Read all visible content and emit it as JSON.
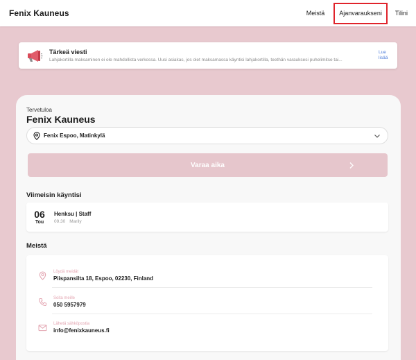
{
  "header": {
    "brand": "Fenix Kauneus",
    "nav": [
      "Meistä",
      "Ajanvaraukseni",
      "Tilini"
    ]
  },
  "notice": {
    "title": "Tärkeä viesti",
    "body": "Lahjakortilla maksaminen ei ole mahdollista verkossa. Uusi asiakas, jos olet maksamassa käyntisi lahjakortilla, teethän varauksesi puhelimitse tai...",
    "more": "Lue lisää",
    "icon": "megaphone-icon"
  },
  "main": {
    "welcome": "Tervetuloa",
    "title": "Fenix Kauneus",
    "location": "Fenix Espoo, Matinkylä",
    "book_button": "Varaa aika",
    "recent_title": "Viimeisin käyntisi",
    "recent_visit": {
      "day": "06",
      "month": "Tou",
      "service": "Henksu | Staff",
      "time": "09.30",
      "staff": "Marily"
    },
    "about_title": "Meistä",
    "contacts": [
      {
        "label": "Löydä meidät",
        "value": "Piispansilta 18, Espoo, 02230, Finland",
        "icon": "map-pin-icon"
      },
      {
        "label": "Soita meille",
        "value": "050 5957979",
        "icon": "phone-icon"
      },
      {
        "label": "Lähetä sähköpostia",
        "value": "info@fenixkauneus.fi",
        "icon": "mail-icon"
      }
    ]
  },
  "colors": {
    "background": "#e8c9cf",
    "accent_button": "#e6c6cc",
    "highlight_border": "#e0232b",
    "icon_pink": "#e3a5b1",
    "link_blue": "#4a7ad9"
  }
}
